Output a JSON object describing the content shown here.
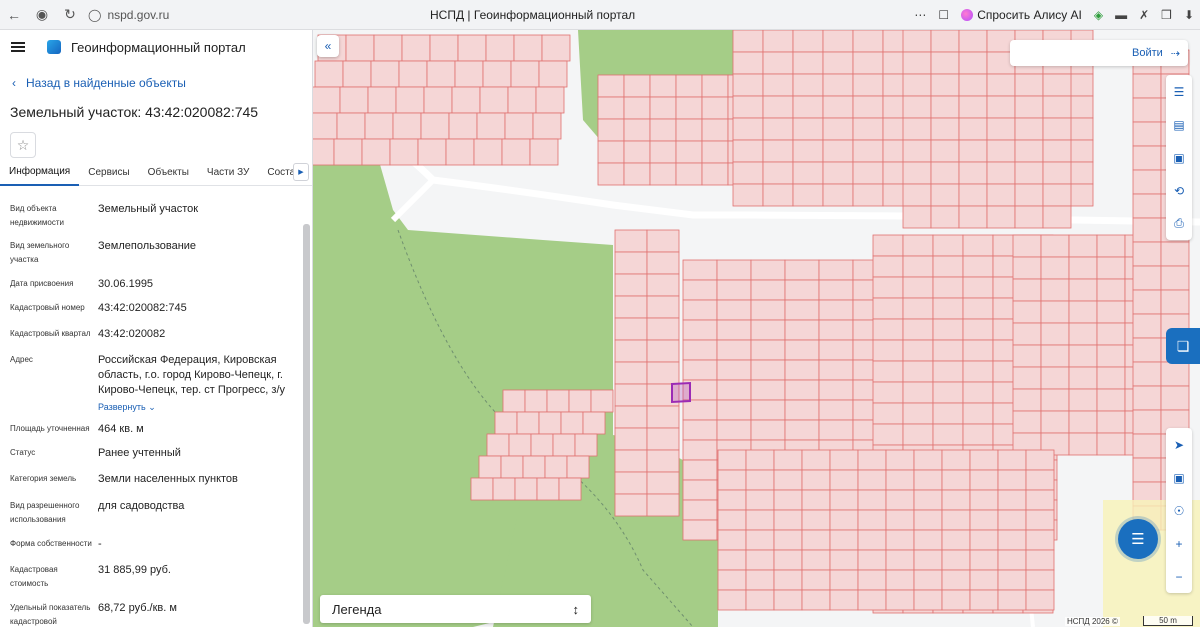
{
  "browser": {
    "url": "nspd.gov.ru",
    "tab_title": "НСПД | Геоинформационный портал",
    "alice_label": "Спросить Алису AI"
  },
  "panel": {
    "app_title": "Геоинформационный портал",
    "back_label": "Назад в найденные объекты",
    "object_title": "Земельный участок: 43:42:020082:745",
    "tabs": [
      "Информация",
      "Сервисы",
      "Объекты",
      "Части ЗУ",
      "Состав"
    ],
    "active_tab": "Информация",
    "fields": [
      {
        "label": "Вид объекта недвижимости",
        "value": "Земельный участок"
      },
      {
        "label": "Вид земельного участка",
        "value": "Землепользование"
      },
      {
        "label": "Дата присвоения",
        "value": "30.06.1995"
      },
      {
        "label": "Кадастровый номер",
        "value": "43:42:020082:745"
      },
      {
        "label": "Кадастровый квартал",
        "value": "43:42:020082"
      },
      {
        "label": "Адрес",
        "value": "Российская Федерация, Кировская область, г.о. город Кирово-Чепецк, г. Кирово-Чепецк, тер. ст Прогресс, з/у"
      },
      {
        "label": "Площадь уточненная",
        "value": "464 кв. м"
      },
      {
        "label": "Статус",
        "value": "Ранее учтенный"
      },
      {
        "label": "Категория земель",
        "value": "Земли населенных пунктов"
      },
      {
        "label": "Вид разрешенного использования",
        "value": "для садоводства"
      },
      {
        "label": "Форма собственности",
        "value": "-"
      },
      {
        "label": "Кадастровая стоимость",
        "value": "31 885,99 руб."
      },
      {
        "label": "Удельный показатель кадастровой",
        "value": "68,72 руб./кв. м"
      }
    ],
    "expand_label": "Развернуть"
  },
  "map": {
    "login_label": "Войти",
    "legend_label": "Легенда",
    "attribution": "НСПД 2026 ©",
    "scale_label": "50 m",
    "colors": {
      "forest": "#a5cd87",
      "parcel_fill": "#f5d6d6",
      "parcel_stroke": "#e0706f",
      "selected": "#9b2bb5",
      "road": "#ffffff",
      "accent": "#1a6fbf"
    }
  }
}
